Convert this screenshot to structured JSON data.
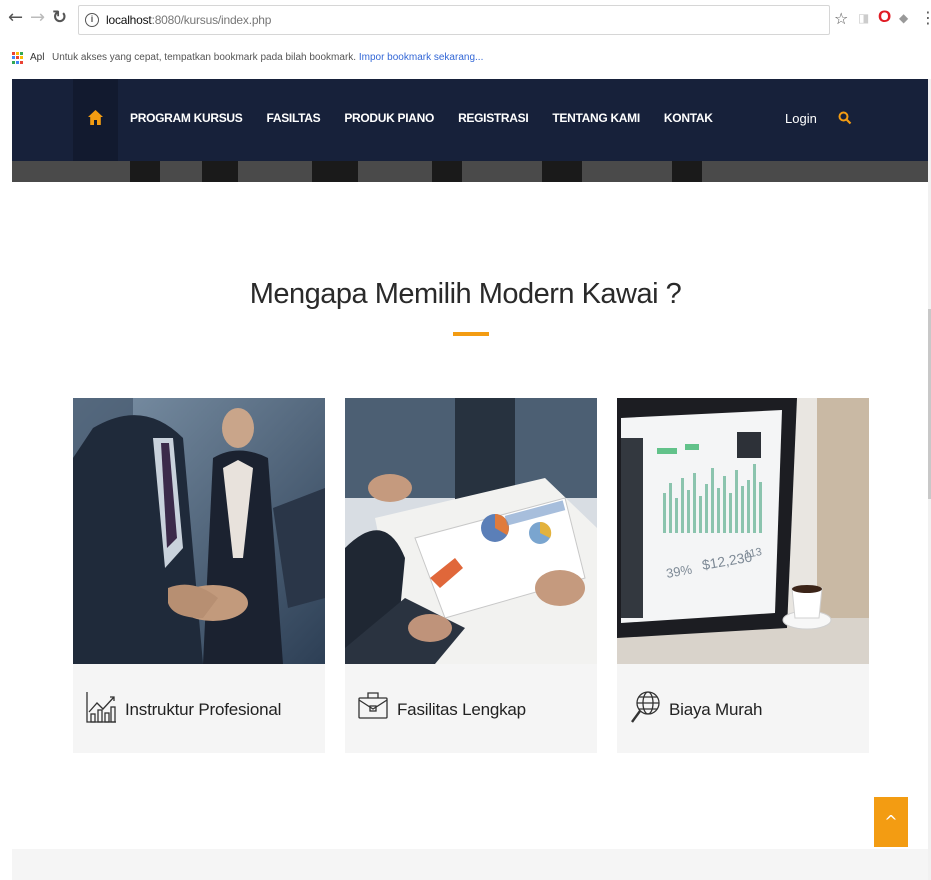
{
  "browser": {
    "back_icon": "arrow-left",
    "forward_icon": "arrow-right",
    "reload_icon": "reload",
    "url_host": "localhost",
    "url_path": ":8080/kursus/index.php",
    "bookmarks": {
      "apps_label": "Apl",
      "message": "Untuk akses yang cepat, tempatkan bookmark pada bilah bookmark.",
      "import_link": "Impor bookmark sekarang..."
    }
  },
  "navbar": {
    "home_icon": "home-icon",
    "links": [
      "PROGRAM KURSUS",
      "FASILTAS",
      "PRODUK PIANO",
      "REGISTRASI",
      "TENTANG KAMI",
      "KONTAK"
    ],
    "login": "Login",
    "search_icon": "search-icon",
    "accent": "#f39c12",
    "background": "#17213a"
  },
  "section": {
    "title": "Mengapa Memilih Modern Kawai ?",
    "cards": [
      {
        "label": "Instruktur Profesional",
        "icon": "bar-chart-icon"
      },
      {
        "label": "Fasilitas Lengkap",
        "icon": "briefcase-icon"
      },
      {
        "label": "Biaya Murah",
        "icon": "globe-search-icon"
      }
    ]
  },
  "scroll_top": {
    "glyph": "^"
  }
}
